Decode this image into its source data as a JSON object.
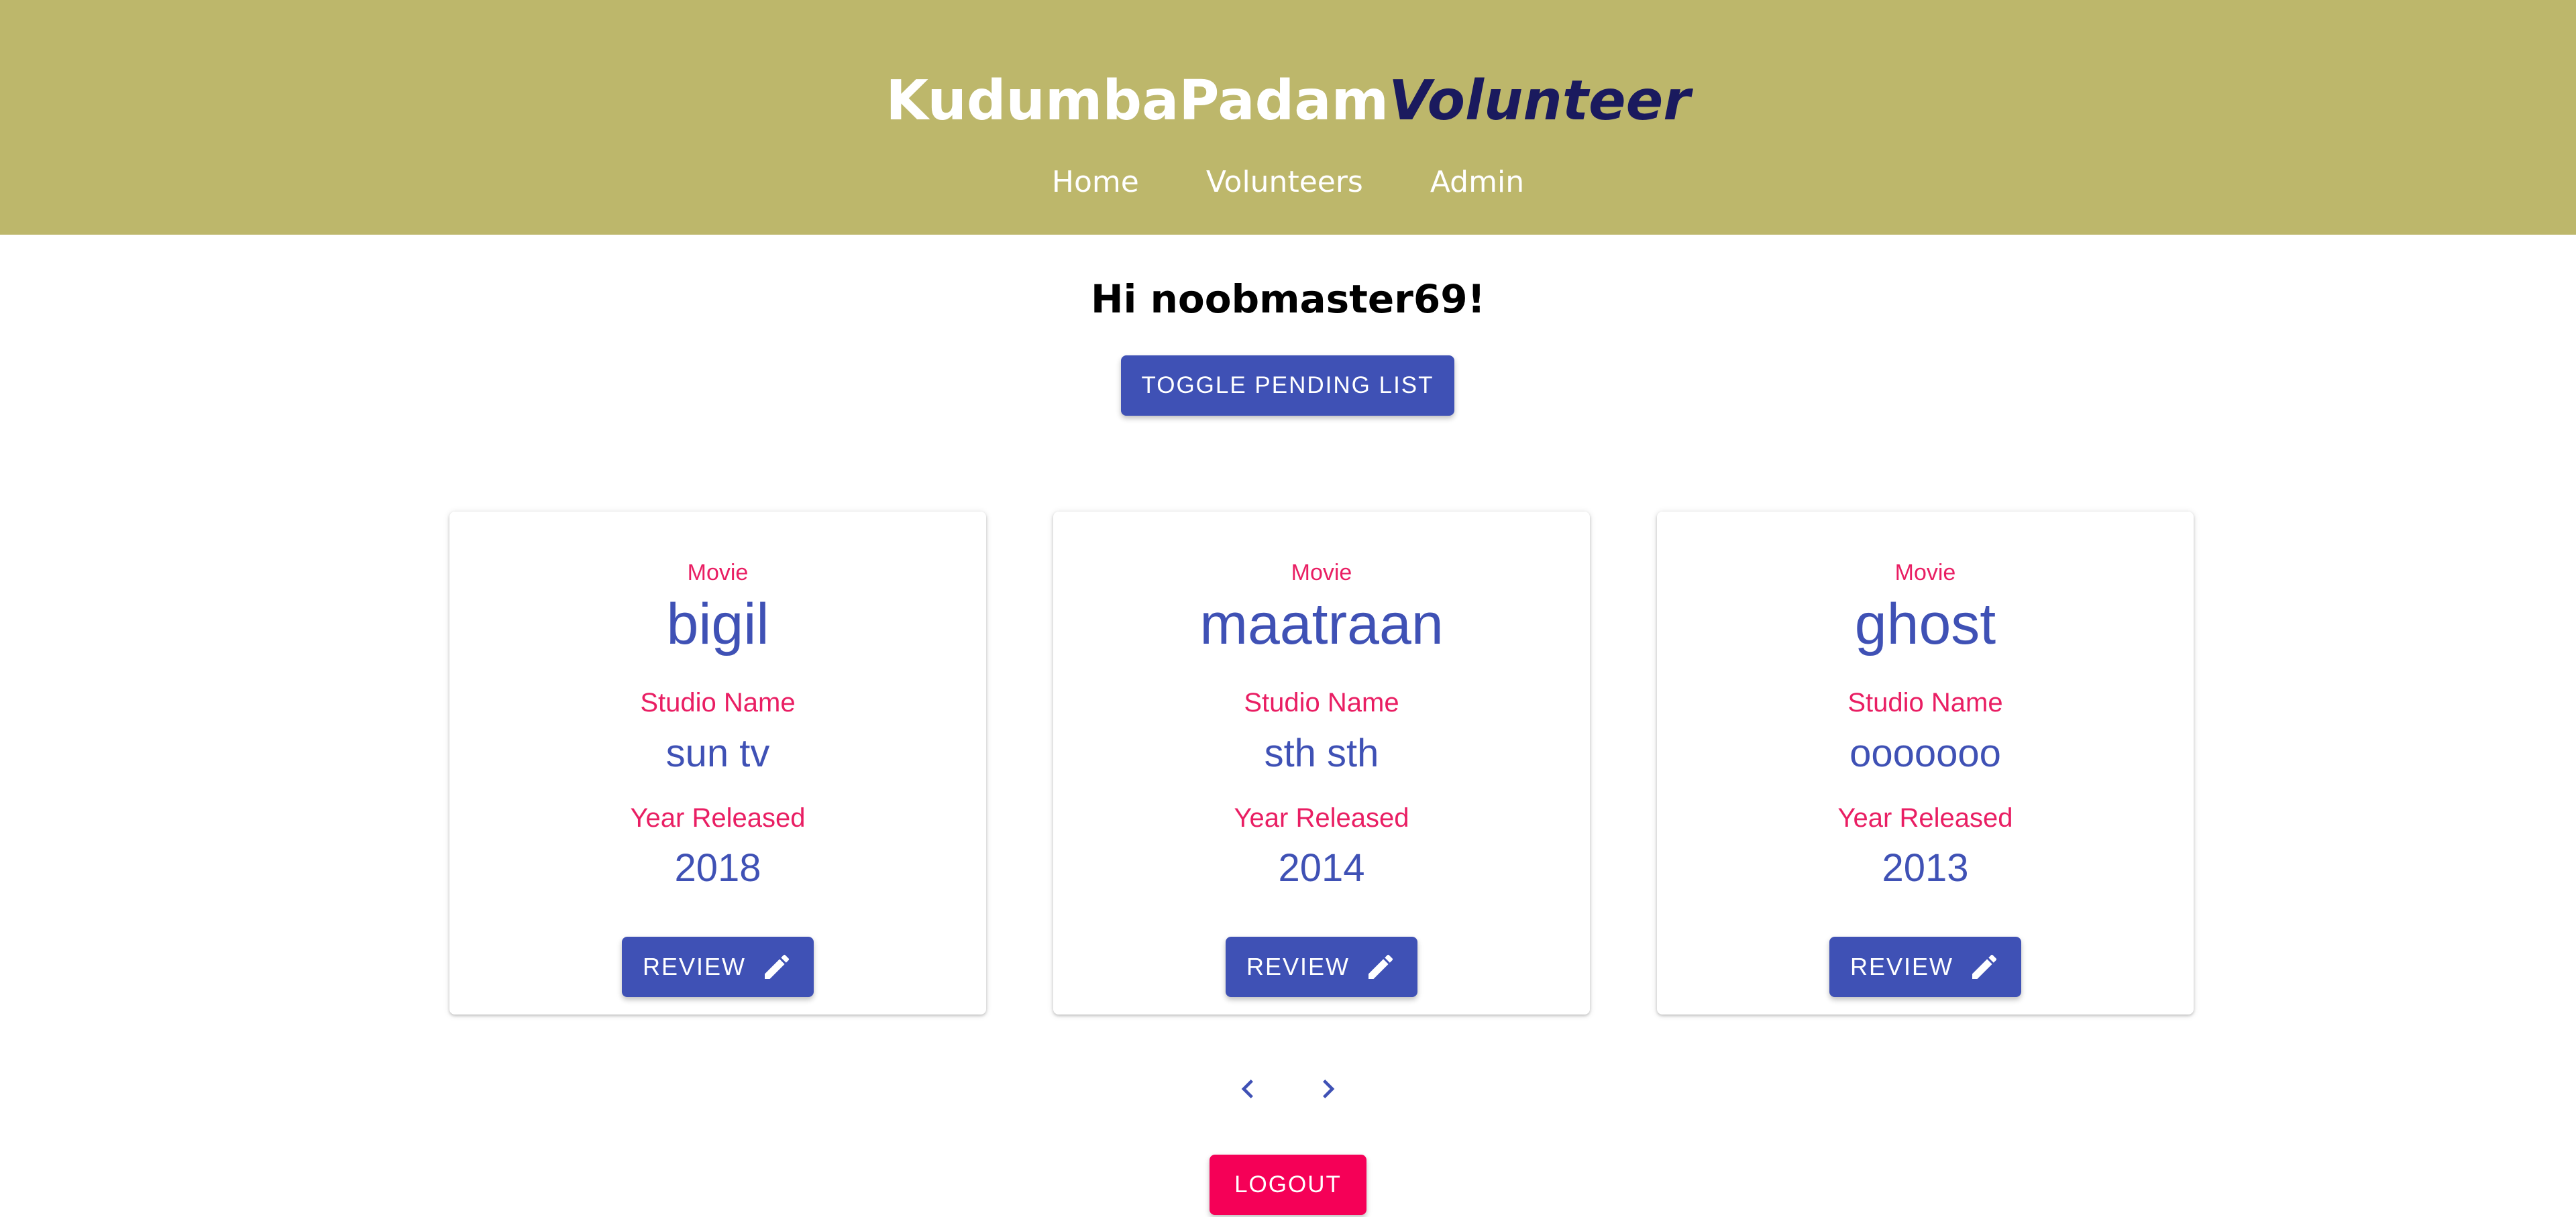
{
  "header": {
    "brand_main": "KudumbaPadam",
    "brand_accent": "Volunteer",
    "nav": [
      "Home",
      "Volunteers",
      "Admin"
    ],
    "background_color": "#bdb76b"
  },
  "greeting": "Hi noobmaster69!",
  "toggle_button_label": "TOGGLE PENDING LIST",
  "cards": [
    {
      "movie_label": "Movie",
      "movie": "bigil",
      "studio_label": "Studio Name",
      "studio": "sun tv",
      "year_label": "Year Released",
      "year": "2018",
      "review_label": "REVIEW"
    },
    {
      "movie_label": "Movie",
      "movie": "maatraan",
      "studio_label": "Studio Name",
      "studio": "sth sth",
      "year_label": "Year Released",
      "year": "2014",
      "review_label": "REVIEW"
    },
    {
      "movie_label": "Movie",
      "movie": "ghost",
      "studio_label": "Studio Name",
      "studio": "ooooooo",
      "year_label": "Year Released",
      "year": "2013",
      "review_label": "REVIEW"
    }
  ],
  "pagination": {
    "prev_icon": "chevron-left-icon",
    "next_icon": "chevron-right-icon"
  },
  "logout_label": "LOGOUT",
  "colors": {
    "primary": "#3f51b5",
    "accent": "#f50057",
    "label": "#e91e63"
  }
}
